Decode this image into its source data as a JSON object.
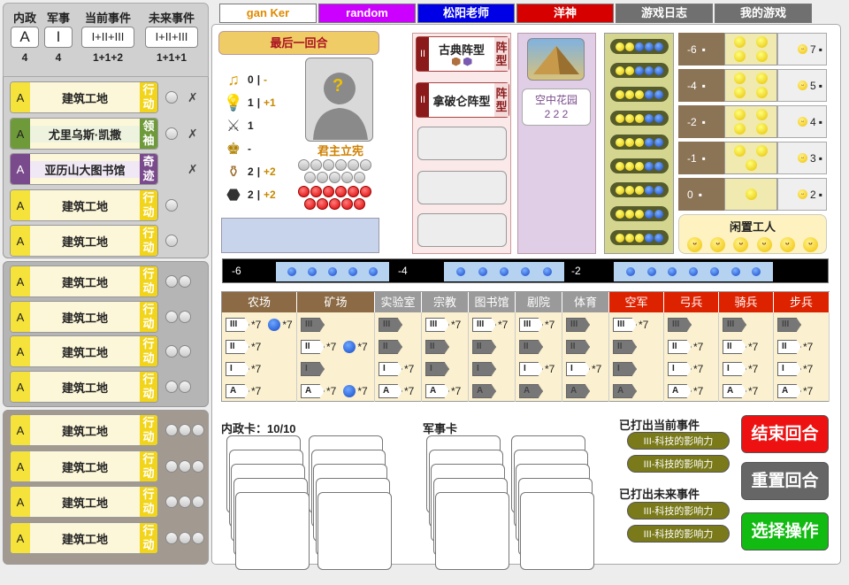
{
  "counters": [
    {
      "label": "内政",
      "box": "A",
      "value": "4"
    },
    {
      "label": "军事",
      "box": "I",
      "value": "4"
    },
    {
      "label": "当前事件",
      "box": "I+II+III",
      "value": "1+1+2"
    },
    {
      "label": "未来事件",
      "box": "I+II+III",
      "value": "1+1+1"
    }
  ],
  "cards": [
    {
      "level": "A",
      "name": "建筑工地",
      "tag": "行动",
      "style": "yellow"
    },
    {
      "level": "A",
      "name": "尤里乌斯·凯撒",
      "tag": "领袖",
      "style": "green"
    },
    {
      "level": "A",
      "name": "亚历山大图书馆",
      "tag": "奇迹",
      "style": "purple"
    },
    {
      "level": "A",
      "name": "建筑工地",
      "tag": "行动",
      "style": "yellow"
    },
    {
      "level": "A",
      "name": "建筑工地",
      "tag": "行动",
      "style": "yellow"
    },
    {
      "level": "A",
      "name": "建筑工地",
      "tag": "行动",
      "style": "yellow"
    },
    {
      "level": "A",
      "name": "建筑工地",
      "tag": "行动",
      "style": "yellow"
    },
    {
      "level": "A",
      "name": "建筑工地",
      "tag": "行动",
      "style": "yellow"
    },
    {
      "level": "A",
      "name": "建筑工地",
      "tag": "行动",
      "style": "yellow"
    },
    {
      "level": "A",
      "name": "建筑工地",
      "tag": "行动",
      "style": "yellow"
    },
    {
      "level": "A",
      "name": "建筑工地",
      "tag": "行动",
      "style": "yellow"
    },
    {
      "level": "A",
      "name": "建筑工地",
      "tag": "行动",
      "style": "yellow"
    },
    {
      "level": "A",
      "name": "建筑工地",
      "tag": "行动",
      "style": "yellow"
    }
  ],
  "x_mark": "✗",
  "tabs": [
    {
      "label": "gan Ker",
      "bg": "#ffffff",
      "fg": "#e08a00"
    },
    {
      "label": "random",
      "bg": "#cc00ff",
      "fg": "#ffffff"
    },
    {
      "label": "松阳老师",
      "bg": "#0000e6",
      "fg": "#ffffff"
    },
    {
      "label": "洋神",
      "bg": "#d60000",
      "fg": "#ffffff"
    },
    {
      "label": "游戏日志",
      "bg": "#707070",
      "fg": "#ffffff"
    },
    {
      "label": "我的游戏",
      "bg": "#707070",
      "fg": "#ffffff"
    }
  ],
  "last_round": "最后一回合",
  "resources": [
    {
      "icon": "♫",
      "value": "0",
      "inc": "-",
      "color": "#d89a00"
    },
    {
      "icon": "💡",
      "value": "1",
      "inc": "+1",
      "color": "#2aa8e0"
    },
    {
      "icon": "⚔",
      "value": "1",
      "inc": "",
      "color": "#555"
    },
    {
      "icon": "♚",
      "value": "-",
      "inc": "",
      "color": "#b08000"
    },
    {
      "icon": "⚱",
      "value": "2",
      "inc": "+2",
      "color": "#a07030"
    },
    {
      "icon": "⬣",
      "value": "2",
      "inc": "+2",
      "color": "#333"
    }
  ],
  "government": "君主立宪",
  "portrait_mark": "?",
  "tactics": [
    {
      "level": "II",
      "name": "古典阵型",
      "tag": "阵型"
    },
    {
      "level": "II",
      "name": "拿破仑阵型",
      "tag": "阵型"
    }
  ],
  "wonder": {
    "name": "空中花园",
    "code": "2 2 2"
  },
  "pop_rows": [
    {
      "num": "-6",
      "count": "7"
    },
    {
      "num": "-4",
      "count": "5"
    },
    {
      "num": "-2",
      "count": "4"
    },
    {
      "num": "-1",
      "count": "3"
    },
    {
      "num": "0",
      "count": "2"
    }
  ],
  "idle_workers": "闲置工人",
  "track": [
    {
      "num": "-6"
    },
    {
      "num": "-4"
    },
    {
      "num": "-2"
    }
  ],
  "tech_headers": [
    {
      "label": "农场",
      "bg": "#8b6a45"
    },
    {
      "label": "矿场",
      "bg": "#8b6a45"
    },
    {
      "label": "实验室",
      "bg": "#9a9a9a"
    },
    {
      "label": "宗教",
      "bg": "#9a9a9a"
    },
    {
      "label": "图书馆",
      "bg": "#9a9a9a"
    },
    {
      "label": "剧院",
      "bg": "#9a9a9a"
    },
    {
      "label": "体育",
      "bg": "#9a9a9a"
    },
    {
      "label": "空军",
      "bg": "#dd2200"
    },
    {
      "label": "弓兵",
      "bg": "#dd2200"
    },
    {
      "label": "骑兵",
      "bg": "#dd2200"
    },
    {
      "label": "步兵",
      "bg": "#dd2200"
    }
  ],
  "tech_levels": [
    "III",
    "II",
    "I",
    "A"
  ],
  "tech_mult": "*7",
  "civil_title": "内政卡：10/10",
  "military_title": "军事卡",
  "current_events_title": "已打出当前事件",
  "future_events_title": "已打出未来事件",
  "event_label": "III-科技的影响力",
  "buttons": [
    {
      "label": "结束回合",
      "bg": "#ee1111"
    },
    {
      "label": "重置回合",
      "bg": "#666666"
    },
    {
      "label": "选择操作",
      "bg": "#11bb11"
    }
  ]
}
